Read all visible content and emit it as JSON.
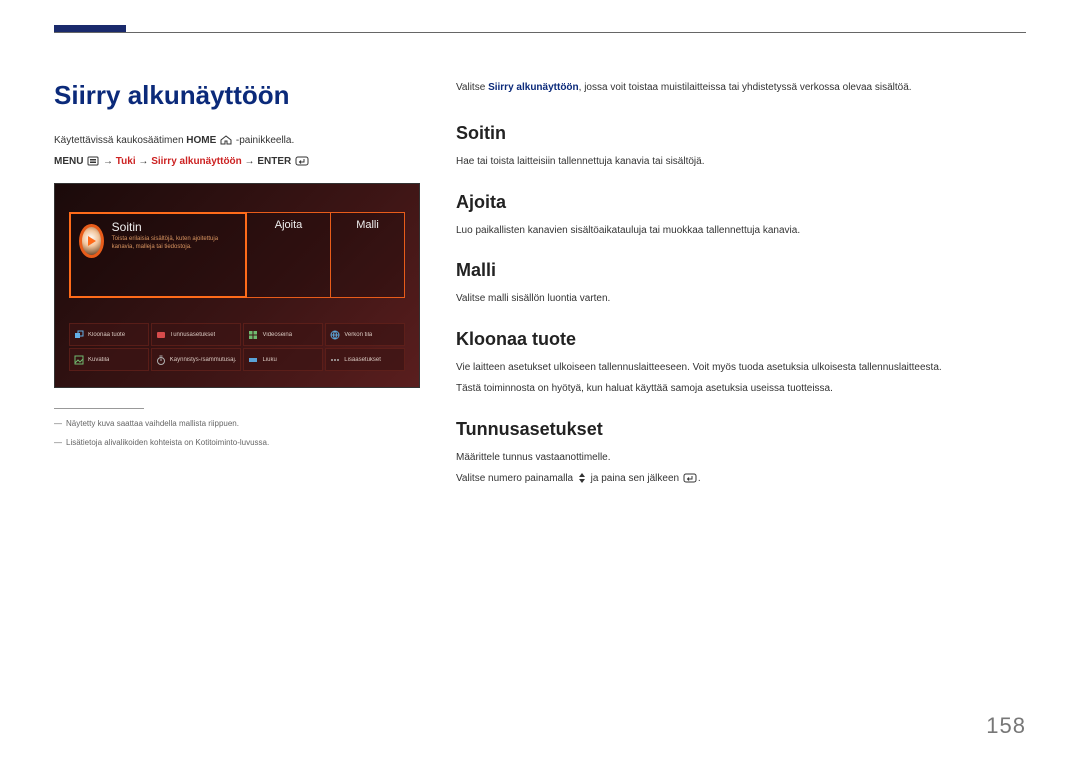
{
  "page_number": "158",
  "title": "Siirry alkunäyttöön",
  "intro_prefix": "Käytettävissä kaukosäätimen ",
  "intro_home_key": "HOME",
  "intro_suffix": " -painikkeella.",
  "path": {
    "menu": "MENU",
    "seg1": "Tuki",
    "seg2": "Siirry alkunäyttöön",
    "enter": "ENTER"
  },
  "screenshot": {
    "tiles": {
      "play_label": "Soitin",
      "play_desc": "Toista erilaisia sisältöjä, kuten ajoitettuja kanavia, malleja tai tiedostoja.",
      "schedule_label": "Ajoita",
      "template_label": "Malli"
    },
    "grid": [
      {
        "icon": "clone-icon",
        "color": "#63b0e8",
        "label": "Kloonaa tuote"
      },
      {
        "icon": "id-icon",
        "color": "#d64b4b",
        "label": "Tunnusasetukset"
      },
      {
        "icon": "video-icon",
        "color": "#6fb96f",
        "label": "Videoseinä"
      },
      {
        "icon": "net-icon",
        "color": "#5aa3d8",
        "label": "Verkon tila"
      },
      {
        "icon": "picture-icon",
        "color": "#6fb96f",
        "label": "Kuvatila"
      },
      {
        "icon": "timer-icon",
        "color": "#b0b0b0",
        "label": "Käynnistys-/sammutusaj."
      },
      {
        "icon": "ticker-icon",
        "color": "#5aa3d8",
        "label": "Liuku"
      },
      {
        "icon": "more-icon",
        "color": "#b0b0b0",
        "label": "Lisäasetukset"
      }
    ]
  },
  "footnotes": [
    "Näytetty kuva saattaa vaihdella mallista riippuen.",
    "Lisätietoja alivalikoiden kohteista on Kotitoiminto-luvussa."
  ],
  "lead_prefix": "Valitse ",
  "lead_hl": "Siirry alkunäyttöön",
  "lead_suffix": ", jossa voit toistaa muistilaitteissa tai yhdistetyssä verkossa olevaa sisältöä.",
  "sections": {
    "soitin": {
      "title": "Soitin",
      "desc": "Hae tai toista laitteisiin tallennettuja kanavia tai sisältöjä."
    },
    "ajoita": {
      "title": "Ajoita",
      "desc": "Luo paikallisten kanavien sisältöaikatauluja tai muokkaa tallennettuja kanavia."
    },
    "malli": {
      "title": "Malli",
      "desc": "Valitse malli sisällön luontia varten."
    },
    "kloonaa": {
      "title": "Kloonaa tuote",
      "desc1": "Vie laitteen asetukset ulkoiseen tallennuslaitteeseen. Voit myös tuoda asetuksia ulkoisesta tallennuslaitteesta.",
      "desc2": "Tästä toiminnosta on hyötyä, kun haluat käyttää samoja asetuksia useissa tuotteissa."
    },
    "tunnus": {
      "title": "Tunnusasetukset",
      "desc1": "Määrittele tunnus vastaanottimelle.",
      "desc2_prefix": "Valitse numero painamalla ",
      "desc2_mid": " ja paina sen jälkeen "
    }
  }
}
